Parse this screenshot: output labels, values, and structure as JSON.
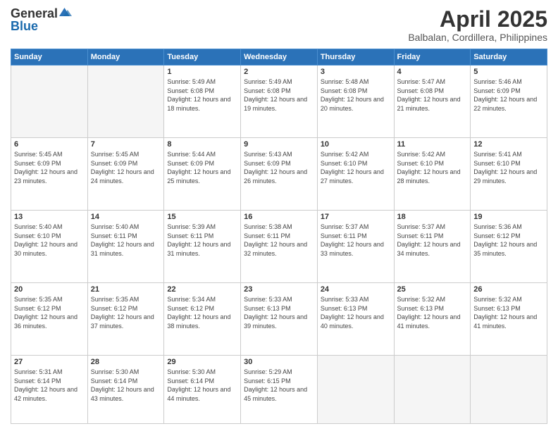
{
  "logo": {
    "general": "General",
    "blue": "Blue"
  },
  "header": {
    "month": "April 2025",
    "location": "Balbalan, Cordillera, Philippines"
  },
  "weekdays": [
    "Sunday",
    "Monday",
    "Tuesday",
    "Wednesday",
    "Thursday",
    "Friday",
    "Saturday"
  ],
  "days": [
    {
      "num": "",
      "empty": true
    },
    {
      "num": "",
      "empty": true
    },
    {
      "num": "1",
      "sunrise": "5:49 AM",
      "sunset": "6:08 PM",
      "daylight": "12 hours and 18 minutes."
    },
    {
      "num": "2",
      "sunrise": "5:49 AM",
      "sunset": "6:08 PM",
      "daylight": "12 hours and 19 minutes."
    },
    {
      "num": "3",
      "sunrise": "5:48 AM",
      "sunset": "6:08 PM",
      "daylight": "12 hours and 20 minutes."
    },
    {
      "num": "4",
      "sunrise": "5:47 AM",
      "sunset": "6:08 PM",
      "daylight": "12 hours and 21 minutes."
    },
    {
      "num": "5",
      "sunrise": "5:46 AM",
      "sunset": "6:09 PM",
      "daylight": "12 hours and 22 minutes."
    },
    {
      "num": "6",
      "sunrise": "5:45 AM",
      "sunset": "6:09 PM",
      "daylight": "12 hours and 23 minutes."
    },
    {
      "num": "7",
      "sunrise": "5:45 AM",
      "sunset": "6:09 PM",
      "daylight": "12 hours and 24 minutes."
    },
    {
      "num": "8",
      "sunrise": "5:44 AM",
      "sunset": "6:09 PM",
      "daylight": "12 hours and 25 minutes."
    },
    {
      "num": "9",
      "sunrise": "5:43 AM",
      "sunset": "6:09 PM",
      "daylight": "12 hours and 26 minutes."
    },
    {
      "num": "10",
      "sunrise": "5:42 AM",
      "sunset": "6:10 PM",
      "daylight": "12 hours and 27 minutes."
    },
    {
      "num": "11",
      "sunrise": "5:42 AM",
      "sunset": "6:10 PM",
      "daylight": "12 hours and 28 minutes."
    },
    {
      "num": "12",
      "sunrise": "5:41 AM",
      "sunset": "6:10 PM",
      "daylight": "12 hours and 29 minutes."
    },
    {
      "num": "13",
      "sunrise": "5:40 AM",
      "sunset": "6:10 PM",
      "daylight": "12 hours and 30 minutes."
    },
    {
      "num": "14",
      "sunrise": "5:40 AM",
      "sunset": "6:11 PM",
      "daylight": "12 hours and 31 minutes."
    },
    {
      "num": "15",
      "sunrise": "5:39 AM",
      "sunset": "6:11 PM",
      "daylight": "12 hours and 31 minutes."
    },
    {
      "num": "16",
      "sunrise": "5:38 AM",
      "sunset": "6:11 PM",
      "daylight": "12 hours and 32 minutes."
    },
    {
      "num": "17",
      "sunrise": "5:37 AM",
      "sunset": "6:11 PM",
      "daylight": "12 hours and 33 minutes."
    },
    {
      "num": "18",
      "sunrise": "5:37 AM",
      "sunset": "6:11 PM",
      "daylight": "12 hours and 34 minutes."
    },
    {
      "num": "19",
      "sunrise": "5:36 AM",
      "sunset": "6:12 PM",
      "daylight": "12 hours and 35 minutes."
    },
    {
      "num": "20",
      "sunrise": "5:35 AM",
      "sunset": "6:12 PM",
      "daylight": "12 hours and 36 minutes."
    },
    {
      "num": "21",
      "sunrise": "5:35 AM",
      "sunset": "6:12 PM",
      "daylight": "12 hours and 37 minutes."
    },
    {
      "num": "22",
      "sunrise": "5:34 AM",
      "sunset": "6:12 PM",
      "daylight": "12 hours and 38 minutes."
    },
    {
      "num": "23",
      "sunrise": "5:33 AM",
      "sunset": "6:13 PM",
      "daylight": "12 hours and 39 minutes."
    },
    {
      "num": "24",
      "sunrise": "5:33 AM",
      "sunset": "6:13 PM",
      "daylight": "12 hours and 40 minutes."
    },
    {
      "num": "25",
      "sunrise": "5:32 AM",
      "sunset": "6:13 PM",
      "daylight": "12 hours and 41 minutes."
    },
    {
      "num": "26",
      "sunrise": "5:32 AM",
      "sunset": "6:13 PM",
      "daylight": "12 hours and 41 minutes."
    },
    {
      "num": "27",
      "sunrise": "5:31 AM",
      "sunset": "6:14 PM",
      "daylight": "12 hours and 42 minutes."
    },
    {
      "num": "28",
      "sunrise": "5:30 AM",
      "sunset": "6:14 PM",
      "daylight": "12 hours and 43 minutes."
    },
    {
      "num": "29",
      "sunrise": "5:30 AM",
      "sunset": "6:14 PM",
      "daylight": "12 hours and 44 minutes."
    },
    {
      "num": "30",
      "sunrise": "5:29 AM",
      "sunset": "6:15 PM",
      "daylight": "12 hours and 45 minutes."
    },
    {
      "num": "",
      "empty": true
    },
    {
      "num": "",
      "empty": true
    },
    {
      "num": "",
      "empty": true
    }
  ]
}
